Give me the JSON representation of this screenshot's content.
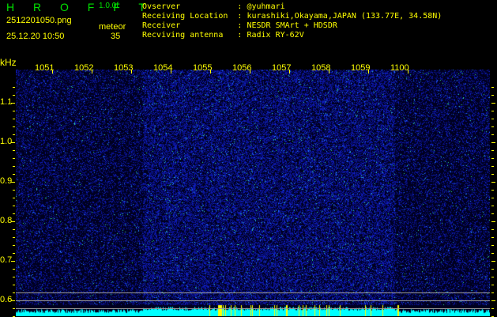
{
  "header": {
    "app_name": "H R O F F T",
    "version": "1.0.0f",
    "filename": "2512201050.png",
    "datetime": "25.12.20 10:50",
    "meteor_label": "meteor",
    "meteor_count": "35"
  },
  "info": [
    {
      "label": "Ovserver            :",
      "value": "@yuhmari"
    },
    {
      "label": "Receiving Location  :",
      "value": "kurashiki,Okayama,JAPAN (133.77E, 34.58N)"
    },
    {
      "label": "Receiver            :",
      "value": "NESDR SMArt + HDSDR"
    },
    {
      "label": "Recviving antenna   :",
      "value": "Radix RY-62V"
    }
  ],
  "axis": {
    "unit": "kHz",
    "x_labels": [
      "1051",
      "1052",
      "1053",
      "1054",
      "1055",
      "1056",
      "1057",
      "1058",
      "1059",
      "1100"
    ],
    "y_labels": [
      "1.1",
      "1.0",
      "0.9",
      "0.8",
      "0.7",
      "0.6"
    ]
  },
  "colors": {
    "background": "#000000",
    "text": "#ffff00",
    "logo": "#00e000",
    "noise": "#1020c0",
    "level": "#00ffff",
    "meteor_mark": "#ffff00"
  }
}
